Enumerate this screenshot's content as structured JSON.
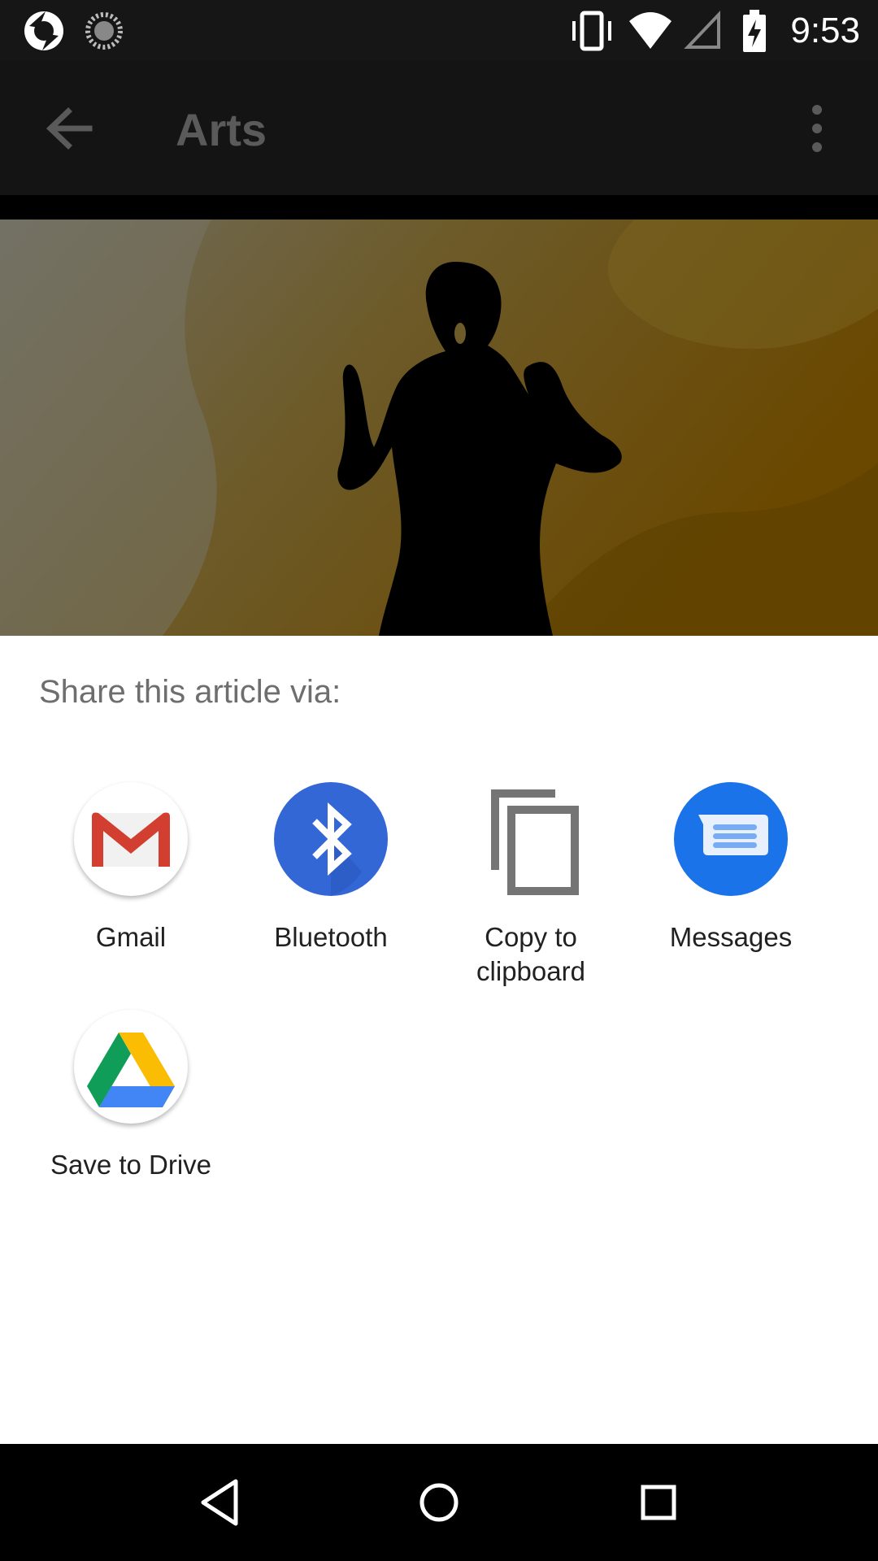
{
  "status_bar": {
    "time": "9:53",
    "icons": [
      "app-notification-icon",
      "sync-icon",
      "vibrate-icon",
      "wifi-icon",
      "no-signal-icon",
      "battery-charging-icon"
    ]
  },
  "app_bar": {
    "title": "Arts",
    "back_icon": "arrow-back-icon",
    "overflow_icon": "more-vert-icon"
  },
  "share_sheet": {
    "title": "Share this article via:",
    "targets": [
      {
        "label": "Gmail",
        "icon": "gmail-icon"
      },
      {
        "label": "Bluetooth",
        "icon": "bluetooth-icon",
        "color": "#3367d6"
      },
      {
        "label": "Copy to\nclipboard",
        "icon": "copy-icon"
      },
      {
        "label": "Messages",
        "icon": "messages-icon",
        "color": "#1a73e8"
      },
      {
        "label": "Save to Drive",
        "icon": "google-drive-icon"
      }
    ]
  },
  "nav_bar": {
    "icons": [
      "back-triangle-icon",
      "home-circle-icon",
      "recents-square-icon"
    ]
  }
}
